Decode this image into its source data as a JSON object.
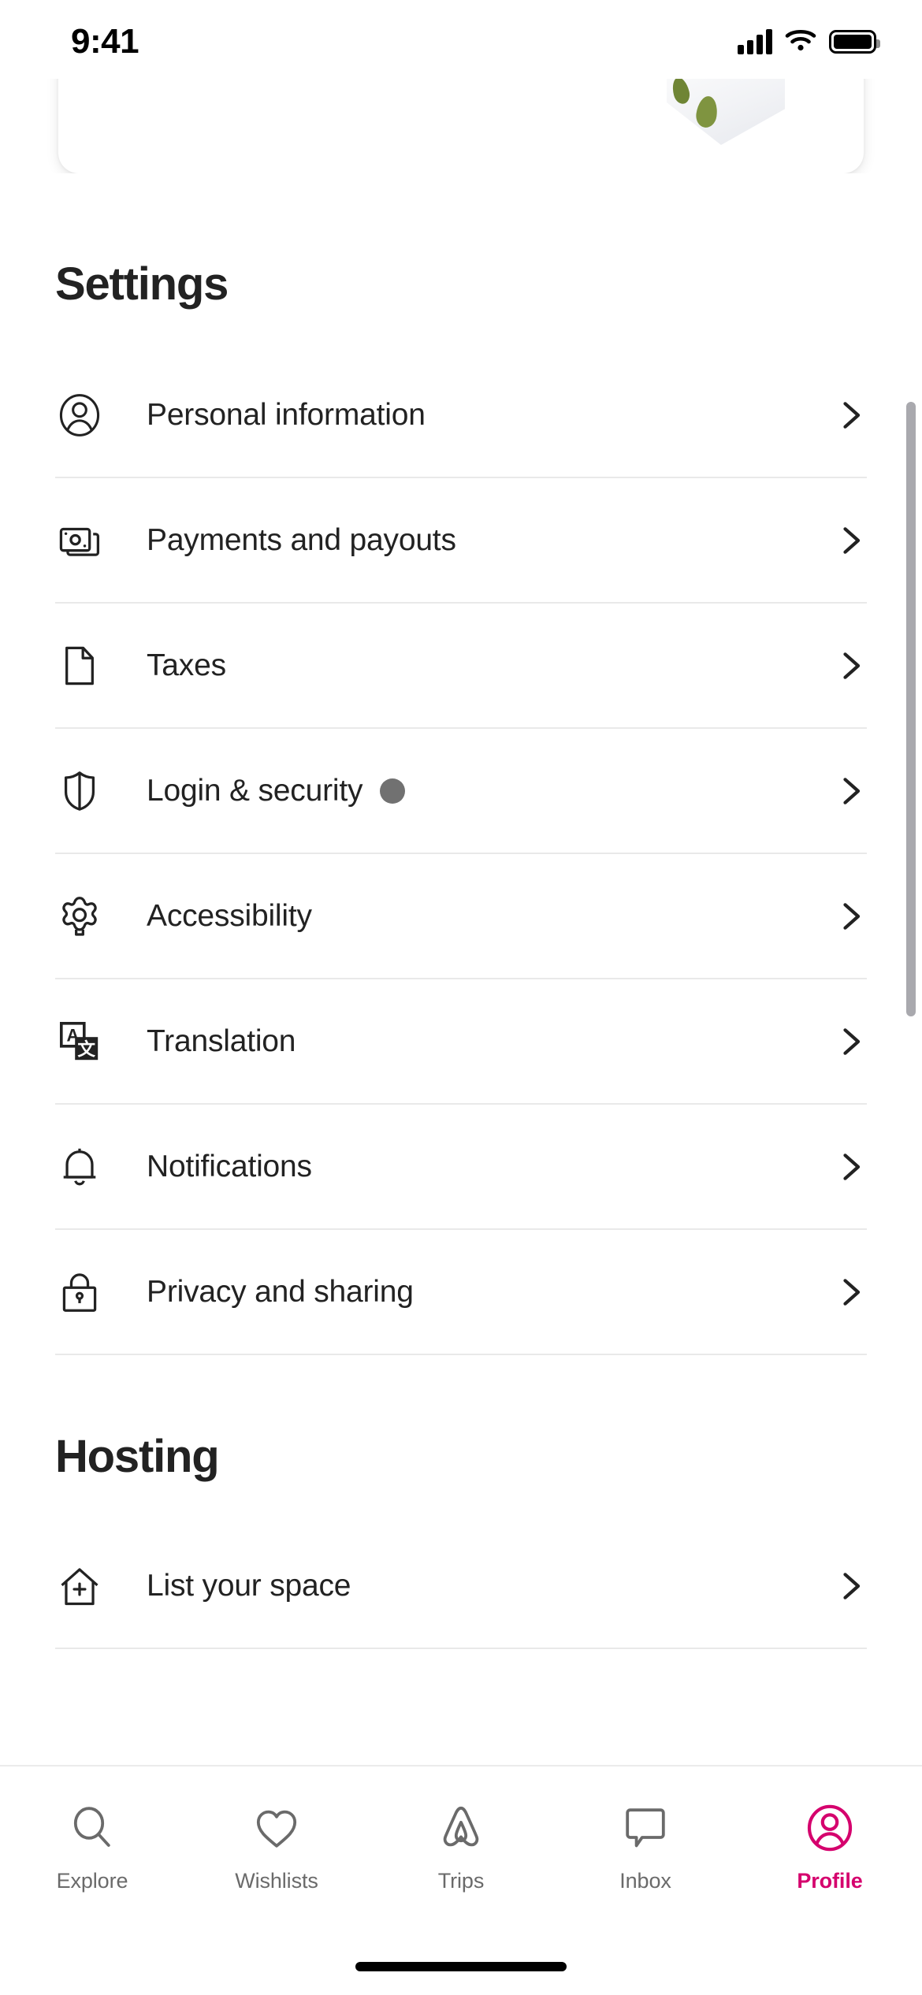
{
  "status_bar": {
    "time": "9:41",
    "icons": [
      "cellular-signal-icon",
      "wifi-icon",
      "battery-icon"
    ]
  },
  "top_card": {
    "type": "partially-scrolled-card",
    "image_alt": "listing-photo"
  },
  "settings": {
    "title": "Settings",
    "items": [
      {
        "label": "Personal information",
        "icon": "person-circle-icon",
        "badge": false
      },
      {
        "label": "Payments and payouts",
        "icon": "banknote-icon",
        "badge": false
      },
      {
        "label": "Taxes",
        "icon": "document-icon",
        "badge": false
      },
      {
        "label": "Login & security",
        "icon": "shield-icon",
        "badge": true
      },
      {
        "label": "Accessibility",
        "icon": "gear-icon",
        "badge": false
      },
      {
        "label": "Translation",
        "icon": "translate-icon",
        "badge": false
      },
      {
        "label": "Notifications",
        "icon": "bell-icon",
        "badge": false
      },
      {
        "label": "Privacy and sharing",
        "icon": "lock-icon",
        "badge": false
      }
    ],
    "chevron_icon": "chevron-right-icon"
  },
  "hosting": {
    "title": "Hosting",
    "items": [
      {
        "label": "List your space",
        "icon": "house-plus-icon",
        "badge": false
      }
    ]
  },
  "tabbar": {
    "active": "Profile",
    "tabs": [
      {
        "label": "Explore",
        "icon": "search-icon",
        "active": false
      },
      {
        "label": "Wishlists",
        "icon": "heart-icon",
        "active": false
      },
      {
        "label": "Trips",
        "icon": "airbnb-belo-icon",
        "active": false
      },
      {
        "label": "Inbox",
        "icon": "message-icon",
        "active": false
      },
      {
        "label": "Profile",
        "icon": "person-circle-icon",
        "active": true
      }
    ]
  },
  "colors": {
    "accent": "#d5006d",
    "text": "#222222",
    "muted": "#6a6a6a",
    "divider": "#e9e9e9",
    "badge": "#717171",
    "background": "#ffffff"
  }
}
